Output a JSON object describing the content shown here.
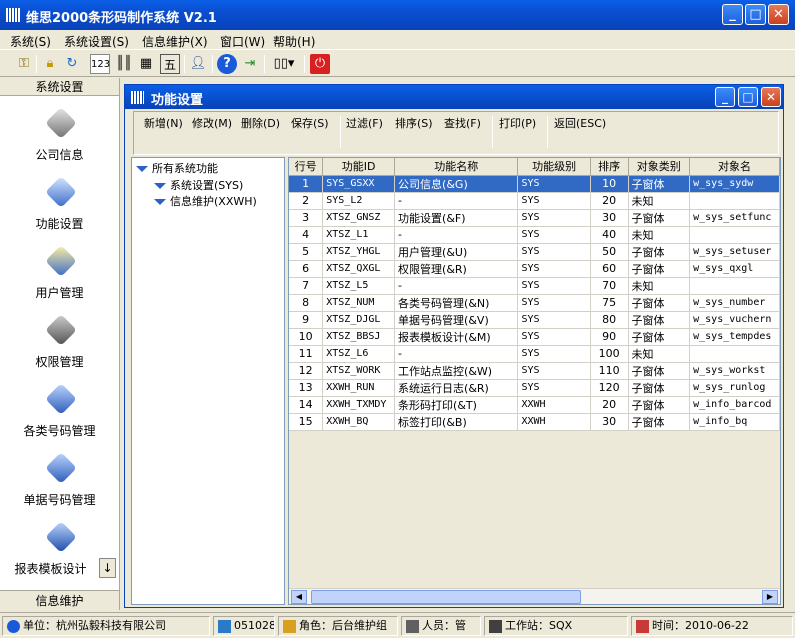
{
  "window": {
    "title": "维思2000条形码制作系统 V2.1",
    "minimize": "_",
    "maximize": "□",
    "close": "✕"
  },
  "menu": [
    "系统(S)",
    "系统设置(S)",
    "信息维护(X)",
    "窗口(W)",
    "帮助(H)"
  ],
  "toolbar": [
    "key-icon",
    "lock-icon",
    "refresh-icon",
    "number-icon",
    "barcode-icon",
    "table-icon",
    "five-icon",
    "user-icon",
    "help-icon",
    "exit-icon",
    "layout-icon",
    "power-icon"
  ],
  "leftnav": {
    "header": "系统设置",
    "footer": "信息维护",
    "items": [
      "公司信息",
      "功能设置",
      "用户管理",
      "权限管理",
      "各类号码管理",
      "单据号码管理",
      "报表模板设计"
    ]
  },
  "child": {
    "title": "功能设置",
    "actions": [
      "新增(N)",
      "修改(M)",
      "删除(D)",
      "保存(S)",
      "过滤(F)",
      "排序(S)",
      "查找(F)",
      "打印(P)",
      "返回(ESC)"
    ]
  },
  "tree": {
    "root": "所有系统功能",
    "children": [
      "系统设置(SYS)",
      "信息维护(XXWH)"
    ]
  },
  "grid": {
    "columns": [
      "行号",
      "功能ID",
      "功能名称",
      "功能级别",
      "排序",
      "对象类别",
      "对象名"
    ],
    "rows": [
      [
        "1",
        "SYS_GSXX",
        "公司信息(&G)",
        "SYS",
        "10",
        "子窗体",
        "w_sys_sydw"
      ],
      [
        "2",
        "SYS_L2",
        "-",
        "SYS",
        "20",
        "未知",
        ""
      ],
      [
        "3",
        "XTSZ_GNSZ",
        "功能设置(&F)",
        "SYS",
        "30",
        "子窗体",
        "w_sys_setfunc"
      ],
      [
        "4",
        "XTSZ_L1",
        "-",
        "SYS",
        "40",
        "未知",
        ""
      ],
      [
        "5",
        "XTSZ_YHGL",
        "用户管理(&U)",
        "SYS",
        "50",
        "子窗体",
        "w_sys_setuser"
      ],
      [
        "6",
        "XTSZ_QXGL",
        "权限管理(&R)",
        "SYS",
        "60",
        "子窗体",
        "w_sys_qxgl"
      ],
      [
        "7",
        "XTSZ_L5",
        "-",
        "SYS",
        "70",
        "未知",
        ""
      ],
      [
        "8",
        "XTSZ_NUM",
        "各类号码管理(&N)",
        "SYS",
        "75",
        "子窗体",
        "w_sys_number"
      ],
      [
        "9",
        "XTSZ_DJGL",
        "单据号码管理(&V)",
        "SYS",
        "80",
        "子窗体",
        "w_sys_vuchern"
      ],
      [
        "10",
        "XTSZ_BBSJ",
        "报表模板设计(&M)",
        "SYS",
        "90",
        "子窗体",
        "w_sys_tempdes"
      ],
      [
        "11",
        "XTSZ_L6",
        "-",
        "SYS",
        "100",
        "未知",
        ""
      ],
      [
        "12",
        "XTSZ_WORK",
        "工作站点监控(&W)",
        "SYS",
        "110",
        "子窗体",
        "w_sys_workst"
      ],
      [
        "13",
        "XXWH_RUN",
        "系统运行日志(&R)",
        "SYS",
        "120",
        "子窗体",
        "w_sys_runlog"
      ],
      [
        "14",
        "XXWH_TXMDY",
        "条形码打印(&T)",
        "XXWH",
        "20",
        "子窗体",
        "w_info_barcod"
      ],
      [
        "15",
        "XXWH_BQ",
        "标签打印(&B)",
        "XXWH",
        "30",
        "子窗体",
        "w_info_bq"
      ]
    ]
  },
  "status": {
    "unit": "单位：杭州弘毅科技有限公司",
    "code": "051028",
    "role": "角色：后台维护组",
    "person": "人员：管",
    "station": "工作站：SQX",
    "time": "时间：2010-06-22"
  },
  "colors": {
    "titlebar": "#0a4ed0",
    "selection": "#316ac5",
    "chrome": "#ece9d8"
  }
}
